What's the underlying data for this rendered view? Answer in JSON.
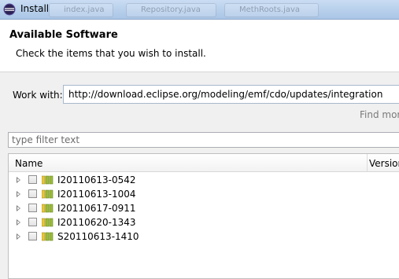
{
  "window": {
    "title": "Install",
    "ghost_tabs": [
      "index.java",
      "Repository.java",
      "MethRoots.java"
    ]
  },
  "header": {
    "title": "Available Software",
    "description": "Check the items that you wish to install."
  },
  "work_with": {
    "label": "Work with:",
    "value": "http://download.eclipse.org/modeling/emf/cdo/updates/integration",
    "find_more": "Find more"
  },
  "filter": {
    "placeholder": "type filter text"
  },
  "tree": {
    "columns": {
      "name": "Name",
      "version": "Version"
    },
    "rows": [
      {
        "label": "I20110613-0542",
        "checked": false
      },
      {
        "label": "I20110613-1004",
        "checked": false
      },
      {
        "label": "I20110617-0911",
        "checked": false
      },
      {
        "label": "I20110620-1343",
        "checked": false
      },
      {
        "label": "S20110613-1410",
        "checked": false
      }
    ]
  },
  "colors": {
    "titlebar": "#b9d1ee",
    "accent": "#a9b8cc",
    "category_icon_green": "#9bbb3b",
    "category_icon_yellow": "#e8c53a"
  }
}
